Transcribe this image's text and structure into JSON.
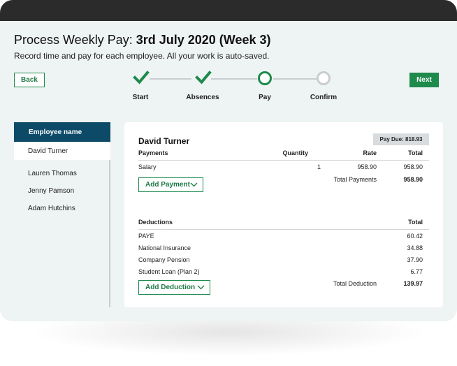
{
  "header": {
    "title_prefix": "Process Weekly Pay: ",
    "title_bold": "3rd July 2020 (Week 3)",
    "subtitle": "Record time and pay for each employee. All your work is auto-saved."
  },
  "nav": {
    "back_label": "Back",
    "next_label": "Next"
  },
  "steps": [
    {
      "label": "Start",
      "state": "complete"
    },
    {
      "label": "Absences",
      "state": "complete"
    },
    {
      "label": "Pay",
      "state": "current"
    },
    {
      "label": "Confirm",
      "state": "pending"
    }
  ],
  "colors": {
    "accent": "#1e8a4c",
    "sidebar_header": "#0c4a68",
    "pending": "#c8cdd0"
  },
  "sidebar": {
    "header": "Employee name",
    "items": [
      {
        "label": "David Turner",
        "active": true
      },
      {
        "label": "Lauren Thomas",
        "active": false
      },
      {
        "label": "Jenny Pamson",
        "active": false
      },
      {
        "label": "Adam Hutchins",
        "active": false
      }
    ]
  },
  "employee": {
    "name": "David Turner",
    "pay_due": "Pay Due: 818.93",
    "payments": {
      "headers": {
        "item": "Payments",
        "quantity": "Quantity",
        "rate": "Rate",
        "total": "Total"
      },
      "rows": [
        {
          "item": "Salary",
          "quantity": "1",
          "rate": "958.90",
          "total": "958.90"
        }
      ],
      "total_label": "Total Payments",
      "total_value": "958.90",
      "add_button": "Add Payment"
    },
    "deductions": {
      "headers": {
        "item": "Deductions",
        "total": "Total"
      },
      "rows": [
        {
          "item": "PAYE",
          "total": "60.42"
        },
        {
          "item": "National Insurance",
          "total": "34.88"
        },
        {
          "item": "Company Pension",
          "total": "37.90"
        },
        {
          "item": "Student Loan (Plan 2)",
          "total": "6.77"
        }
      ],
      "total_label": "Total Deduction",
      "total_value": "139.97",
      "add_button": "Add Deduction"
    }
  }
}
